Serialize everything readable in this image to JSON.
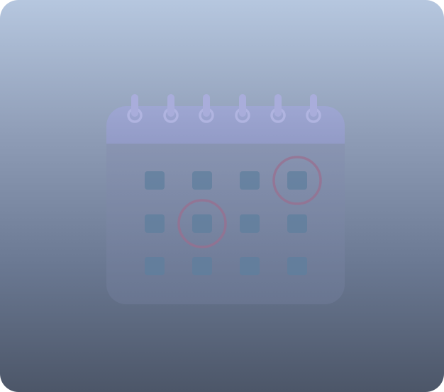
{
  "illustration": {
    "name": "calendar-icon",
    "colors": {
      "background_top": "#b6c7df",
      "background_bottom": "#4c5668",
      "calendar_header": "#9aa2cf",
      "calendar_body": "#7f8aa8",
      "ring": "#a5a9da",
      "day_cell": "#5f7f9e",
      "highlight_circle": "#9a6f8f"
    },
    "rings": 6,
    "grid_rows": 3,
    "grid_cols": 4,
    "highlighted_cells": [
      {
        "row": 1,
        "col": 4
      },
      {
        "row": 2,
        "col": 2
      }
    ]
  }
}
